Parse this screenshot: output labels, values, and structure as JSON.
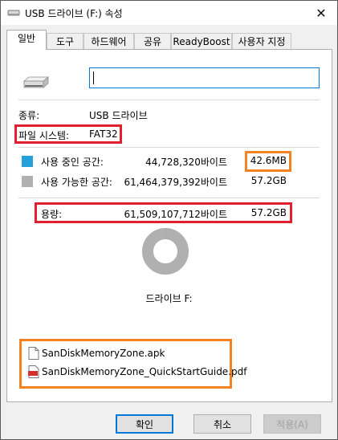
{
  "window": {
    "title": "USB 드라이브 (F:) 속성",
    "close_glyph": "✕"
  },
  "tabs": [
    {
      "label": "일반",
      "active": true
    },
    {
      "label": "도구"
    },
    {
      "label": "하드웨어"
    },
    {
      "label": "공유"
    },
    {
      "label": "ReadyBoost"
    },
    {
      "label": "사용자 지정"
    }
  ],
  "general": {
    "drive_name_value": "",
    "type_label": "종류:",
    "type_value": "USB 드라이브",
    "filesystem_label": "파일 시스템:",
    "filesystem_value": "FAT32",
    "used": {
      "label": "사용 중인 공간:",
      "bytes": "44,728,320바이트",
      "size": "42.6MB",
      "color": "#26a0da"
    },
    "free": {
      "label": "사용 가능한 공간:",
      "bytes": "61,464,379,392바이트",
      "size": "57.2GB",
      "color": "#b0b0b0"
    },
    "capacity": {
      "label": "용량:",
      "bytes": "61,509,107,712바이트",
      "size": "57.2GB"
    },
    "drive_label": "드라이브 F:",
    "used_fraction": 0.0007
  },
  "files": [
    {
      "name": "SanDiskMemoryZone.apk",
      "icon": "document-icon"
    },
    {
      "name": "SanDiskMemoryZone_QuickStartGuide.pdf",
      "icon": "pdf-icon"
    }
  ],
  "buttons": {
    "ok": "확인",
    "cancel": "취소",
    "apply": "적용(A)"
  },
  "highlight_colors": {
    "red": "#e0202e",
    "orange": "#f58220"
  }
}
